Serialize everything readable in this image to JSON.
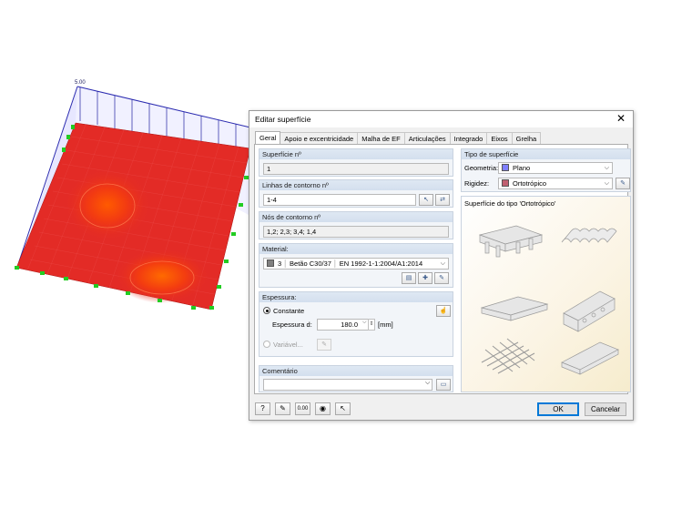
{
  "model": {
    "load_value": "5.00"
  },
  "dialog": {
    "title": "Editar superfície",
    "close_glyph": "✕",
    "tabs": [
      {
        "label": "Geral",
        "active": true
      },
      {
        "label": "Apoio e excentricidade",
        "active": false
      },
      {
        "label": "Malha de EF",
        "active": false
      },
      {
        "label": "Articulações",
        "active": false
      },
      {
        "label": "Integrado",
        "active": false
      },
      {
        "label": "Eixos",
        "active": false
      },
      {
        "label": "Grelha",
        "active": false
      }
    ],
    "surface_no": {
      "header": "Superfície nº",
      "value": "1"
    },
    "boundary_lines": {
      "header": "Linhas de contorno nº",
      "value": "1-4"
    },
    "boundary_nodes": {
      "header": "Nós de contorno nº",
      "value": "1,2; 2,3; 3,4; 1,4"
    },
    "material": {
      "header": "Material:",
      "number": "3",
      "name": "Betão C30/37",
      "standard": "EN 1992-1-1:2004/A1:2014",
      "color": "#808080"
    },
    "thickness": {
      "header": "Espessura:",
      "constant_label": "Constante",
      "thickness_label": "Espessura d:",
      "thickness_value": "180.0",
      "unit": "[mm]",
      "variable_label": "Variável..."
    },
    "comment": {
      "header": "Comentário",
      "value": ""
    },
    "surface_type": {
      "header": "Tipo de superfície",
      "geometry_label": "Geometria:",
      "geometry_value": "Plano",
      "geometry_color": "#8080ff",
      "stiffness_label": "Rigidez:",
      "stiffness_value": "Ortotrópico",
      "stiffness_color": "#c06070"
    },
    "preview_caption": "Superfície do tipo 'Ortotrópico'",
    "buttons": {
      "ok": "OK",
      "cancel": "Cancelar"
    }
  }
}
